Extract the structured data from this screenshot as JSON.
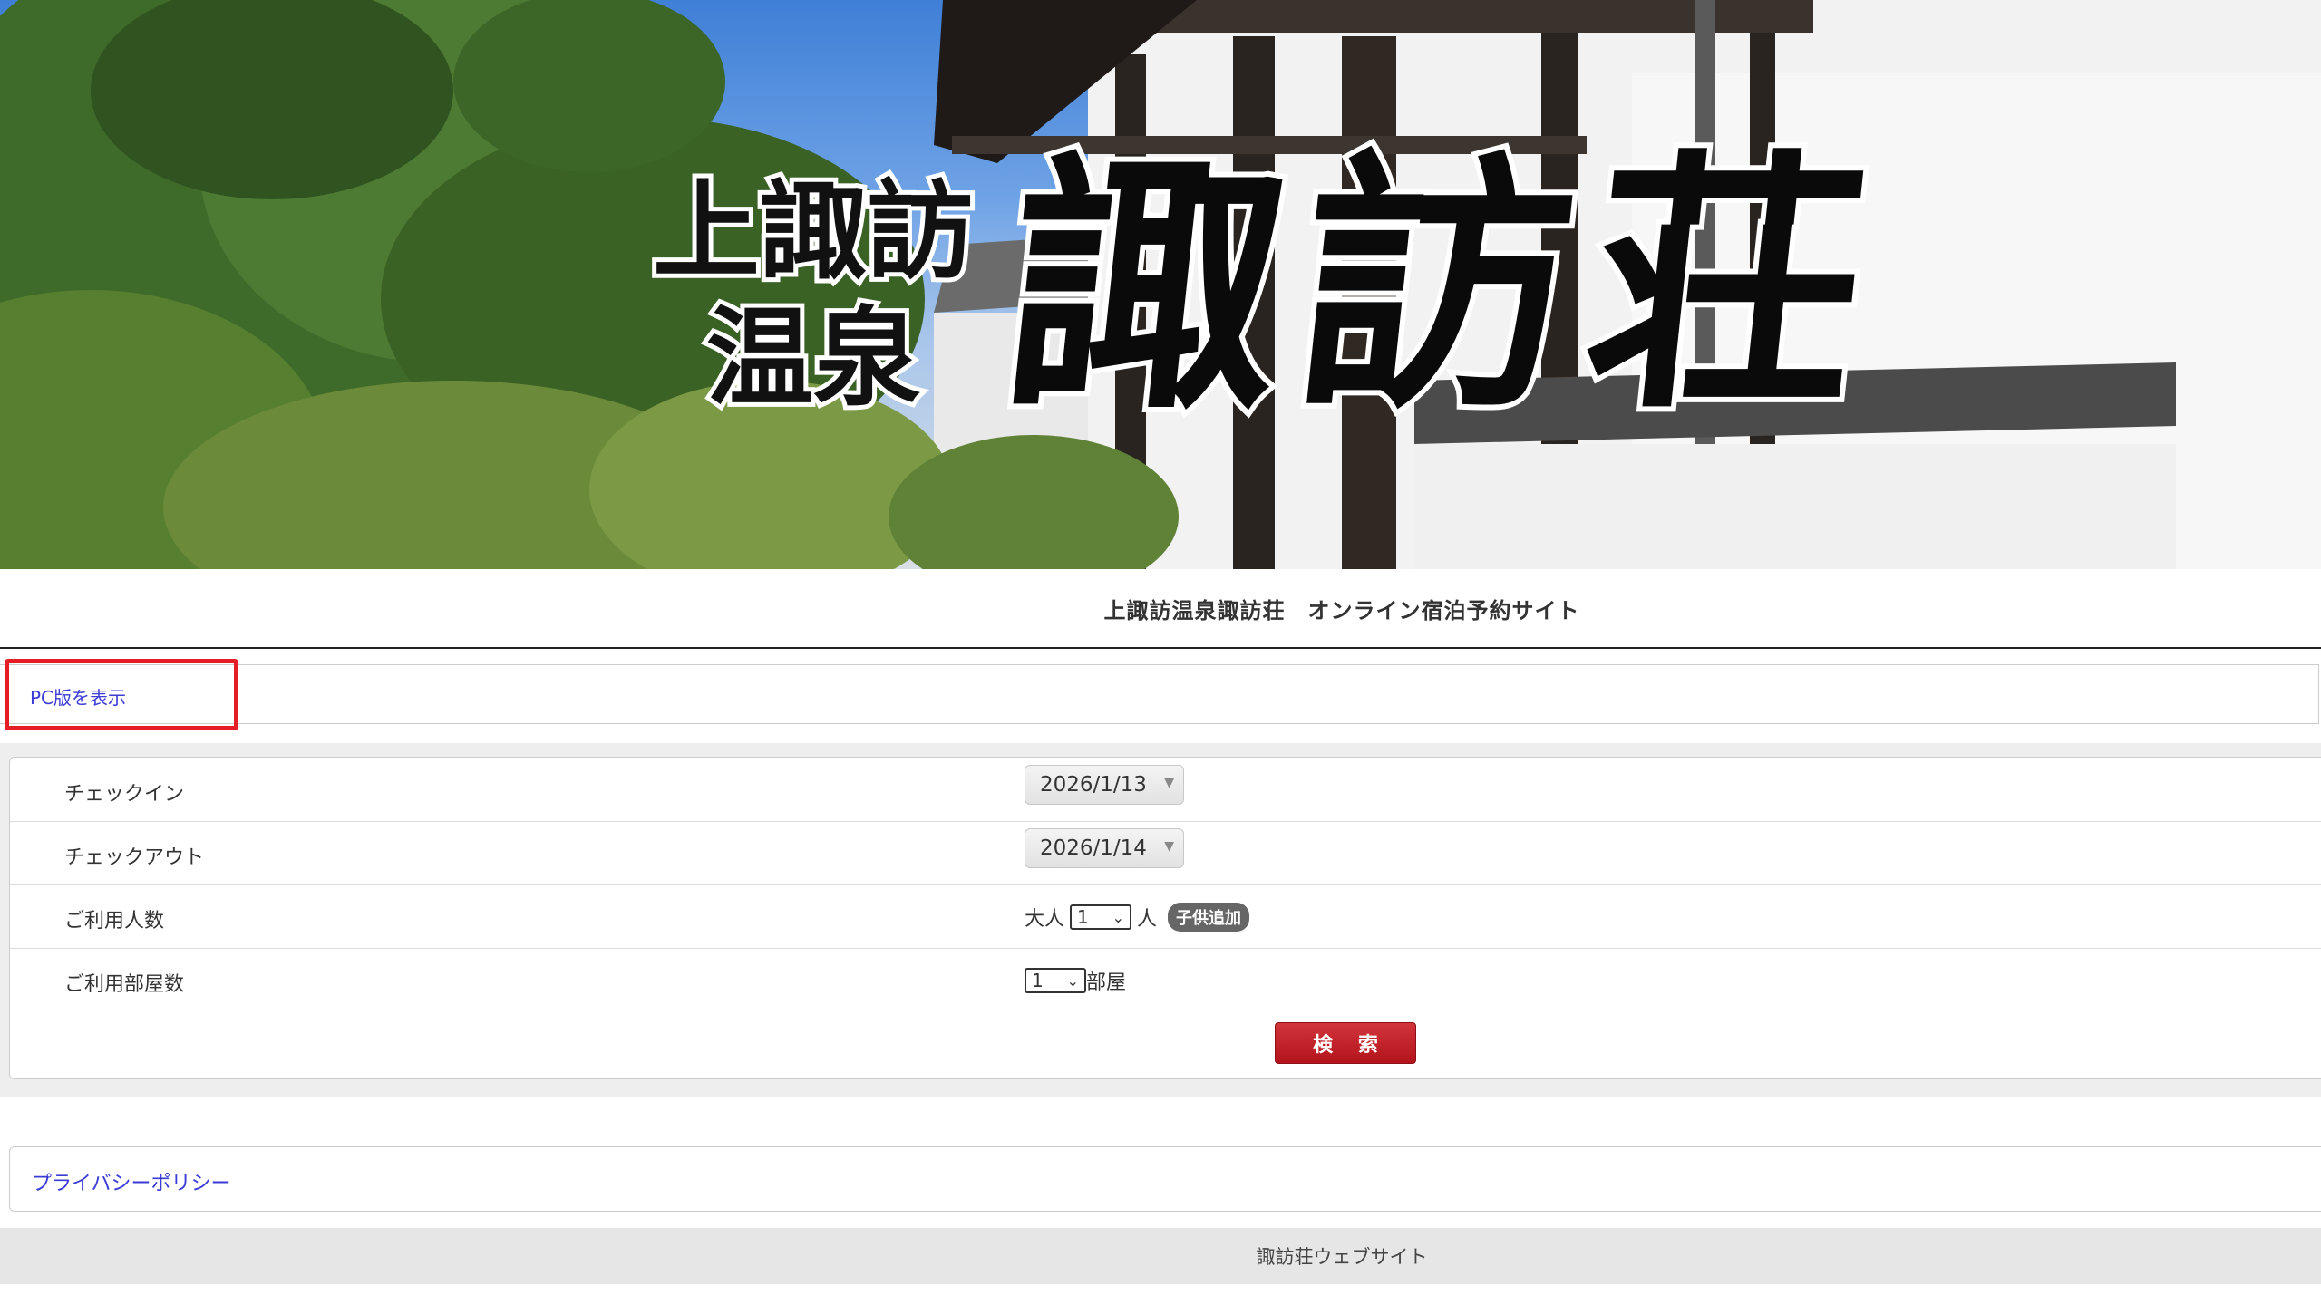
{
  "hero": {
    "subtitle_line1": "上諏訪",
    "subtitle_line2": "温泉",
    "main_title": "諏訪荘"
  },
  "site_title": "上諏訪温泉諏訪荘　オンライン宿泊予約サイト",
  "pc_link": "PC版を表示",
  "form": {
    "checkin_label": "チェックイン",
    "checkin_value": "2026/1/13",
    "checkout_label": "チェックアウト",
    "checkout_value": "2026/1/14",
    "guests_label": "ご利用人数",
    "adults_label": "大人",
    "adults_value": "1",
    "persons_unit": "人",
    "add_child_button": "子供追加",
    "rooms_label": "ご利用部屋数",
    "rooms_value": "1",
    "rooms_unit": "部屋",
    "search_button": "検 索"
  },
  "privacy_link": "プライバシーポリシー",
  "footer_text": "諏訪荘ウェブサイト",
  "colors": {
    "link": "#3b3bd6",
    "search_button": "#c41e24",
    "highlight": "#e51e25"
  }
}
